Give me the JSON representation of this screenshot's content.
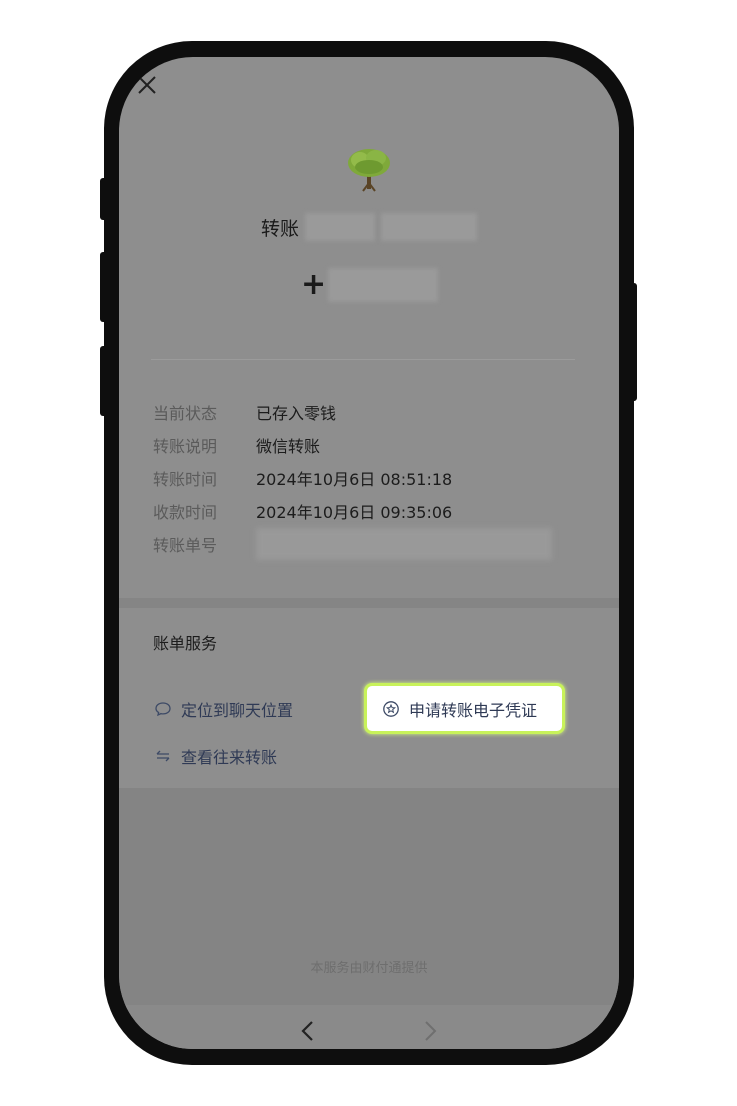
{
  "header": {
    "transfer_label": "转账",
    "amount_sign": "+"
  },
  "details": [
    {
      "label": "当前状态",
      "value": "已存入零钱"
    },
    {
      "label": "转账说明",
      "value": "微信转账"
    },
    {
      "label": "转账时间",
      "value": "2024年10月6日 08:51:18"
    },
    {
      "label": "收款时间",
      "value": "2024年10月6日 09:35:06"
    },
    {
      "label": "转账单号",
      "value": ""
    }
  ],
  "services": {
    "title": "账单服务",
    "locate_chat": "定位到聊天位置",
    "apply_voucher": "申请转账电子凭证",
    "view_history": "查看往来转账"
  },
  "footer": {
    "provider": "本服务由财付通提供"
  },
  "colors": {
    "highlight_border": "#c8f25a",
    "link_text": "#2f3a55"
  },
  "icons": {
    "close": "close-icon",
    "chat": "chat-bubble-icon",
    "voucher": "star-circle-icon",
    "history": "swap-arrows-icon",
    "back": "chevron-left-icon",
    "forward": "chevron-right-icon"
  }
}
